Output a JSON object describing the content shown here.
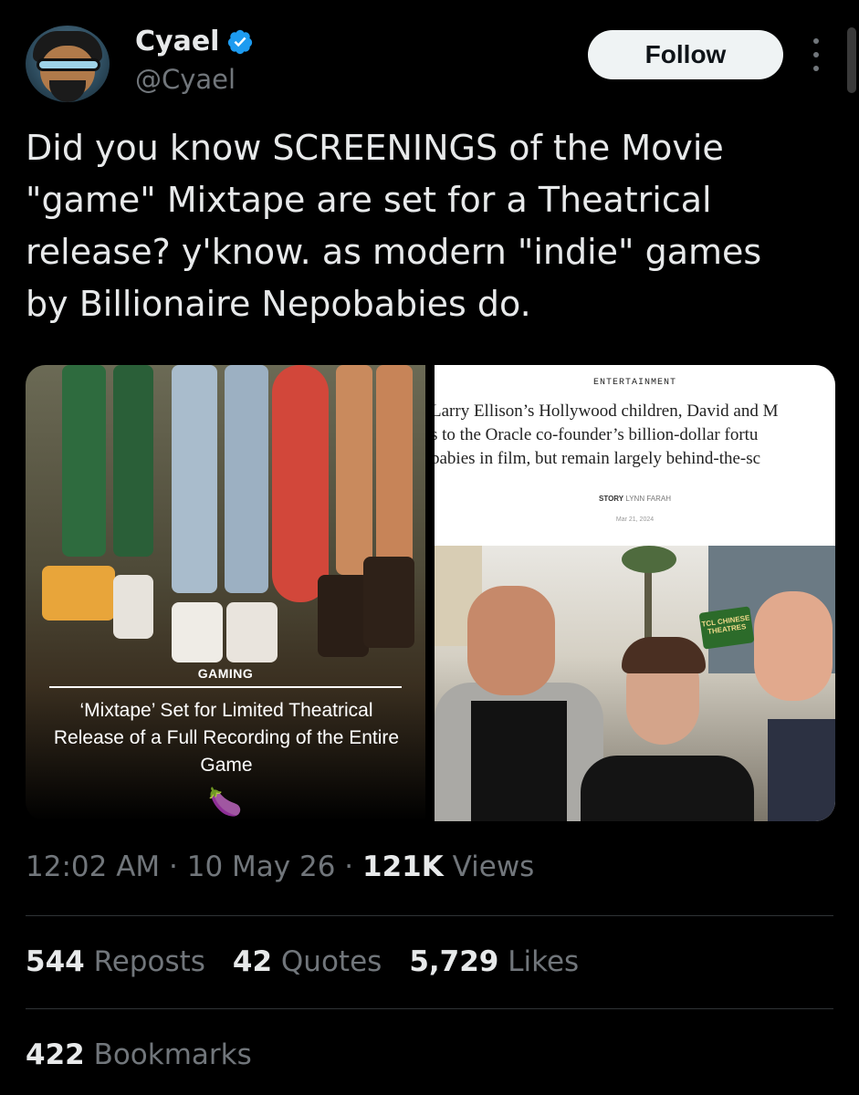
{
  "author": {
    "name": "Cyael",
    "handle": "@Cyael",
    "verified_color": "#1d9bf0"
  },
  "follow_label": "Follow",
  "tweet_text": "Did you know SCREENINGS of the Movie\n\"game\" Mixtape are set for a Theatrical\nrelease? y'know. as modern \"indie\" games\nby Billionaire Nepobabies do.",
  "media": {
    "left": {
      "category": "GAMING",
      "headline": "‘Mixtape’ Set for Limited Theatrical Release of a Full Recording of the Entire Game",
      "icon": "eggplant-icon"
    },
    "right": {
      "category": "ENTERTAINMENT",
      "lines": [
        "Larry Ellison’s Hollywood children, David and M",
        "s to the Oracle co-founder’s billion-dollar fortu",
        "babies in film, but remain largely behind-the-sc"
      ],
      "byline_label": "STORY",
      "byline_author": "LYNN FARAH",
      "date": "Mar 21, 2024",
      "sign_text": "TCL CHINESE THEATRES"
    }
  },
  "meta": {
    "time": "12:02 AM",
    "date": "10 May 26",
    "views_count": "121K",
    "views_label": "Views"
  },
  "stats": {
    "reposts_count": "544",
    "reposts_label": "Reposts",
    "quotes_count": "42",
    "quotes_label": "Quotes",
    "likes_count": "5,729",
    "likes_label": "Likes",
    "bookmarks_count": "422",
    "bookmarks_label": "Bookmarks"
  }
}
